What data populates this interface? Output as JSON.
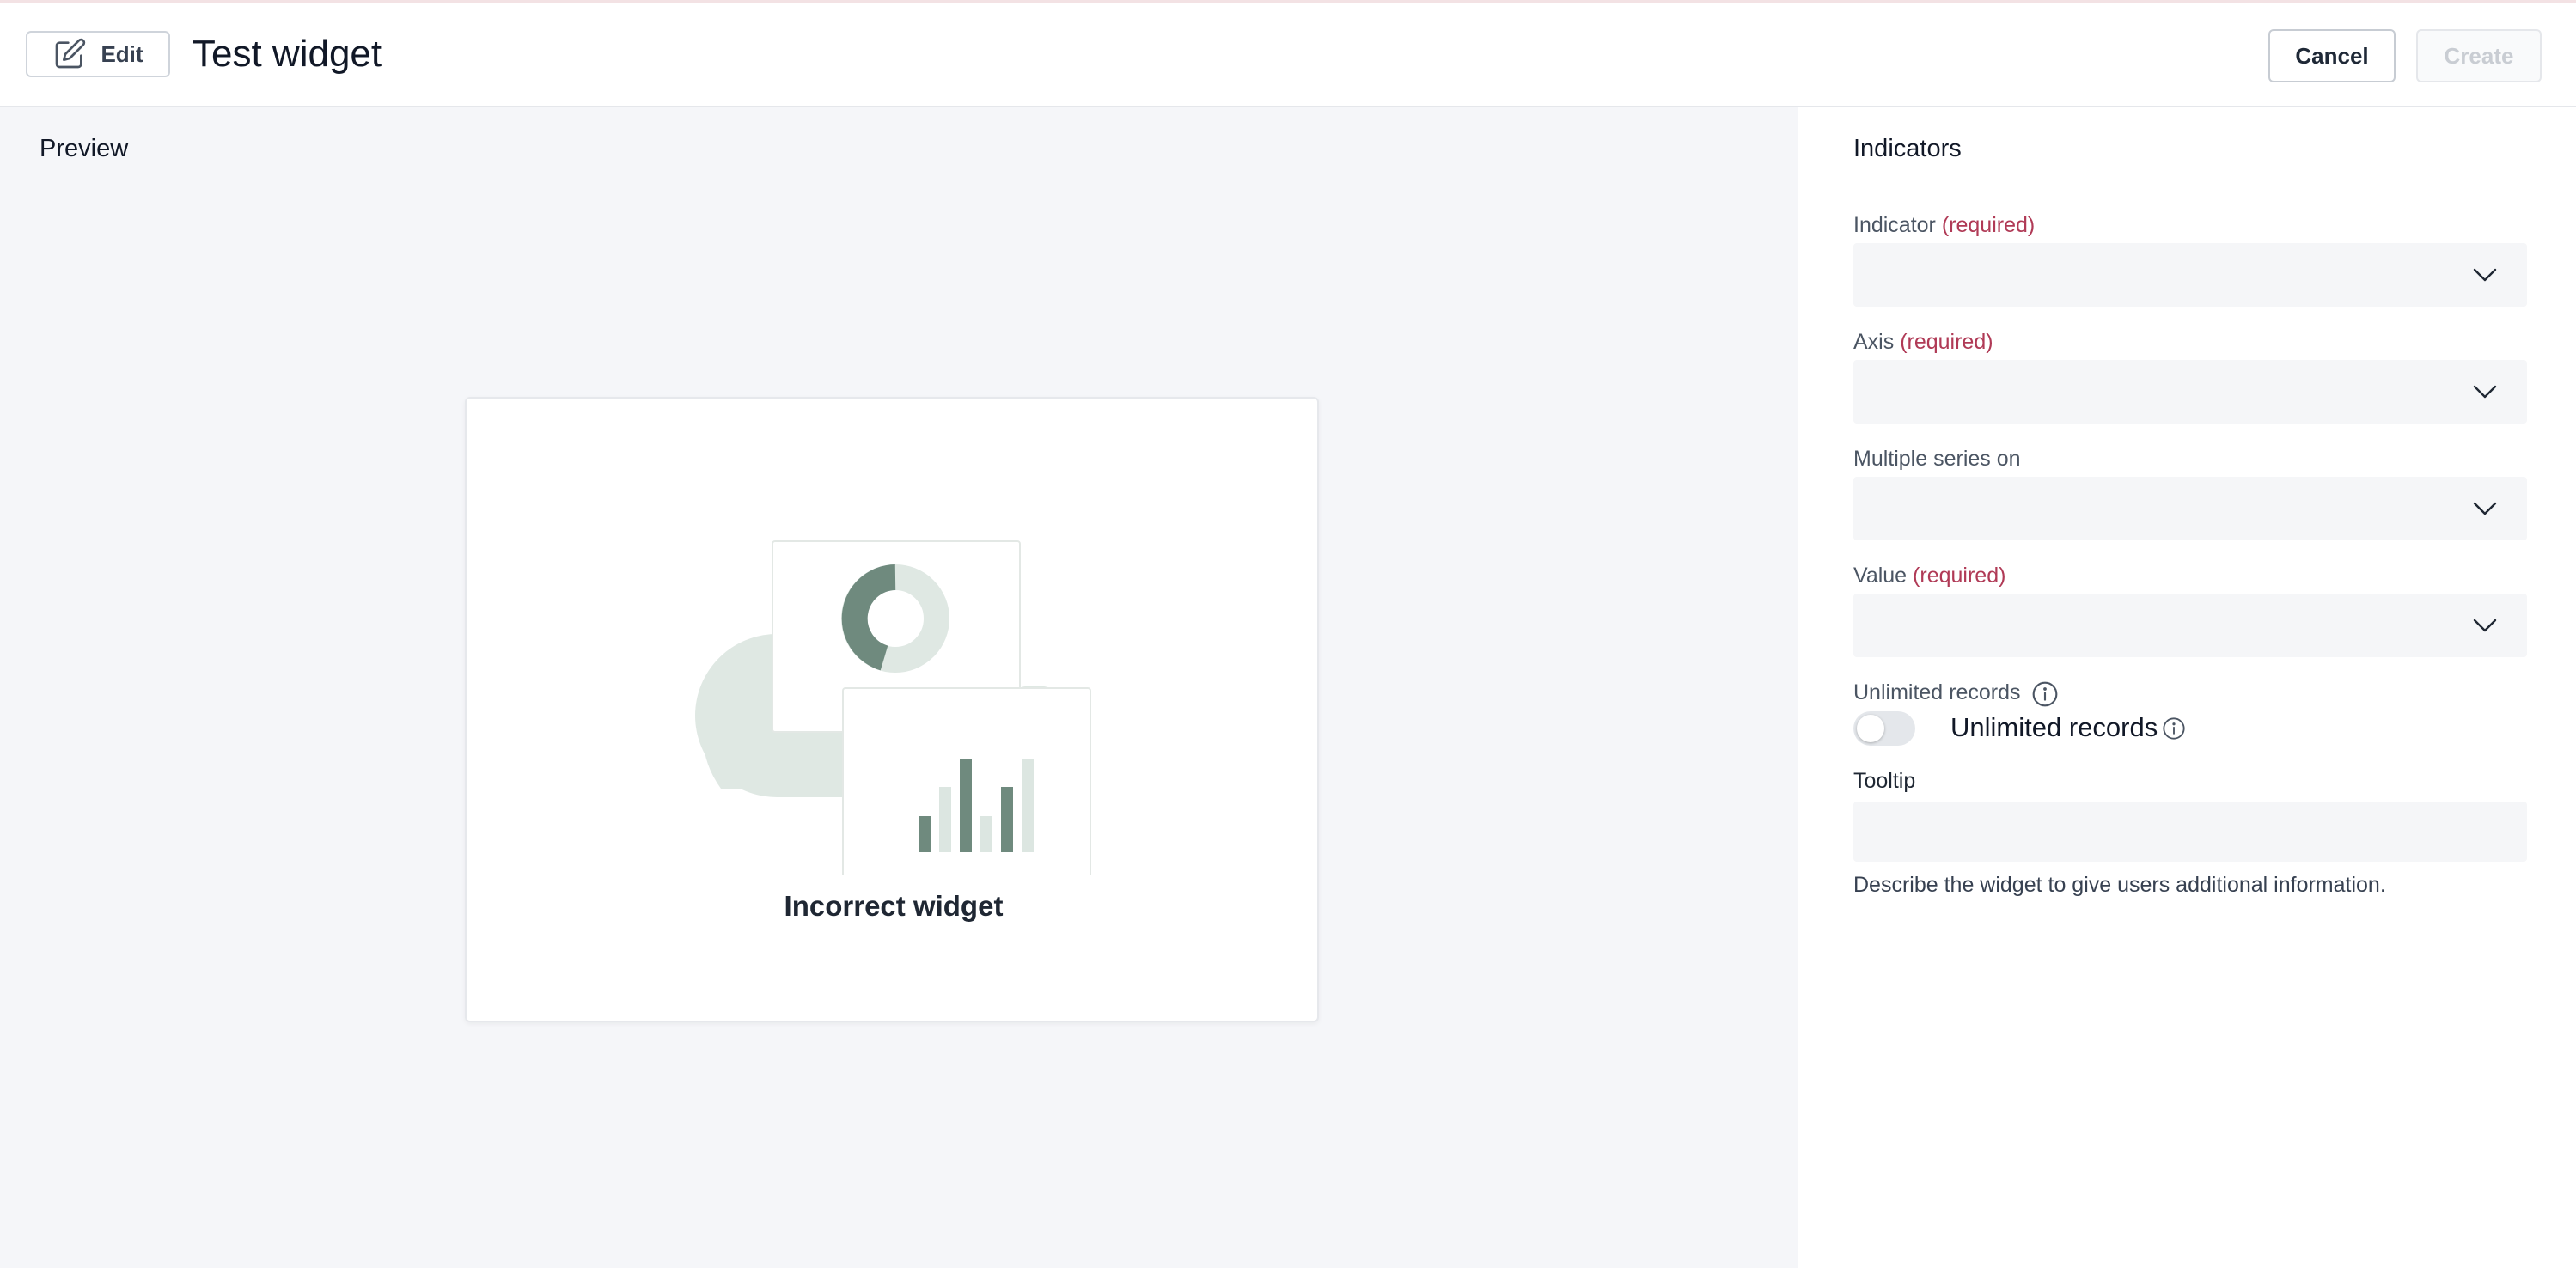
{
  "header": {
    "edit_label": "Edit",
    "title": "Test widget",
    "cancel_label": "Cancel",
    "create_label": "Create"
  },
  "preview": {
    "heading": "Preview",
    "message": "Incorrect widget"
  },
  "panel": {
    "title": "Indicators",
    "fields": {
      "indicator": {
        "label": "Indicator",
        "required_text": "(required)",
        "value": ""
      },
      "axis": {
        "label": "Axis",
        "required_text": "(required)",
        "value": ""
      },
      "multiple_series": {
        "label": "Multiple series on",
        "value": ""
      },
      "value": {
        "label": "Value",
        "required_text": "(required)",
        "value": ""
      }
    },
    "unlimited_records": {
      "label": "Unlimited records",
      "toggle_label": "Unlimited records",
      "enabled": false
    },
    "tooltip": {
      "label": "Tooltip",
      "value": "",
      "helper": "Describe the widget to give users additional information."
    }
  },
  "colors": {
    "required": "#b03a56",
    "illustration_dark": "#6f8a7e",
    "illustration_light": "#dce6e1"
  },
  "icons": [
    "edit-pencil-icon",
    "chevron-down-icon",
    "info-icon"
  ]
}
